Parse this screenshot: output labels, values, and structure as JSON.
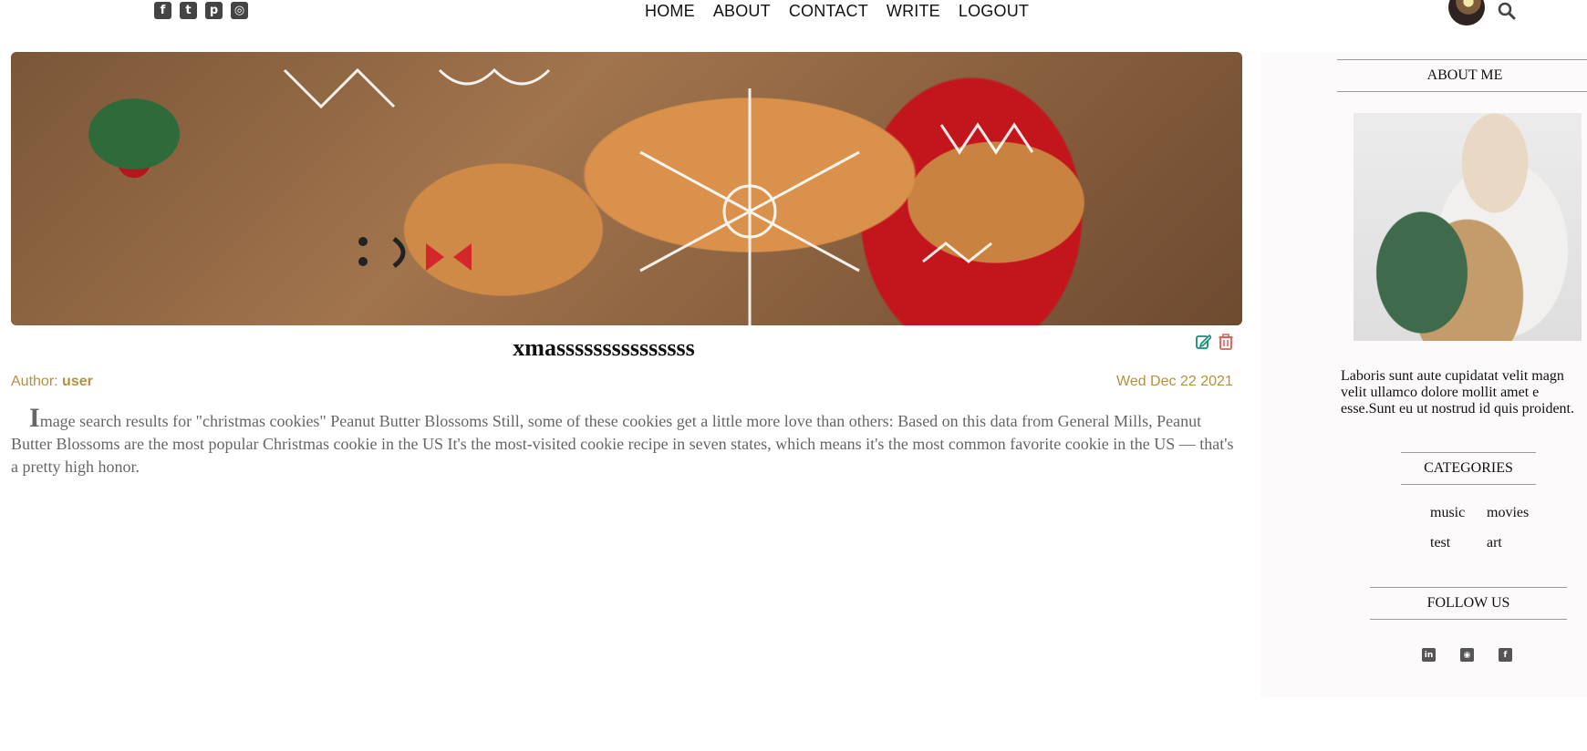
{
  "header": {
    "social_icons": [
      "facebook-square-icon",
      "twitter-square-icon",
      "pinterest-square-icon",
      "instagram-square-icon"
    ],
    "nav": [
      "HOME",
      "ABOUT",
      "CONTACT",
      "WRITE",
      "LOGOUT"
    ]
  },
  "post": {
    "title": "xmasssssssssssssss",
    "author_label": "Author:",
    "author": "user",
    "date": "Wed Dec 22 2021",
    "body_dropcap": "I",
    "body": "mage search results for \"christmas cookies\" Peanut Butter Blossoms Still, some of these cookies get a little more love than others: Based on this data from General Mills, Peanut Butter Blossoms are the most popular Christmas cookie in the US It's the most-visited cookie recipe in seven states, which means it's the most common favorite cookie in the US — that's a pretty high honor."
  },
  "sidebar": {
    "about_title": "ABOUT ME",
    "about_text_lines": [
      "Laboris sunt aute cupidatat velit magn",
      "velit ullamco dolore mollit amet e",
      "esse.Sunt eu ut nostrud id quis proident."
    ],
    "categories_title": "CATEGORIES",
    "categories": [
      "music",
      "movies",
      "test",
      "art"
    ],
    "follow_title": "FOLLOW US",
    "follow_icons": [
      "linkedin-icon",
      "github-icon",
      "facebook-icon"
    ]
  },
  "colors": {
    "accent": "#b5913f",
    "edit": "#1a8a7a",
    "delete": "#e05a4f"
  }
}
